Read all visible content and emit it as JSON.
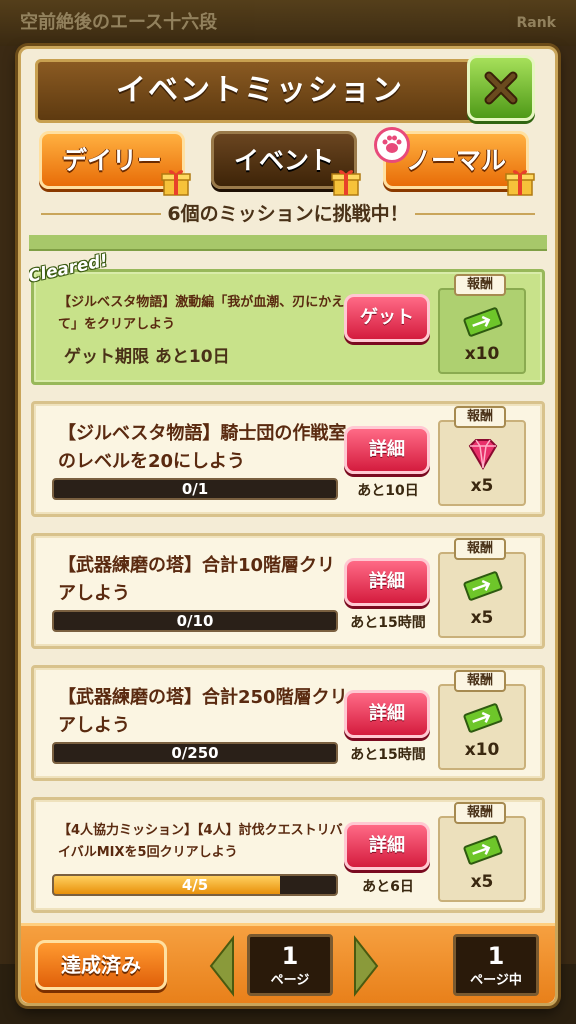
{
  "background": {
    "top_left_text": "空前絶後のエース十六段",
    "top_right_text": "Rank"
  },
  "header": {
    "title": "イベントミッション"
  },
  "tabs": [
    {
      "label": "デイリー"
    },
    {
      "label": "イベント"
    },
    {
      "label": "ノーマル"
    }
  ],
  "subtitle": "6個のミッションに挑戦中！",
  "missions": [
    {
      "cleared_tag": "Cleared!",
      "title": "【ジルベスタ物語】激動編「我が血潮、刃にかえて」をクリアしよう",
      "limit": "ゲット期限 あと10日",
      "button": "ゲット",
      "reward_label": "報酬",
      "reward_icon": "ticket-icon",
      "reward_qty": "x10"
    },
    {
      "title": "【ジルベスタ物語】騎士団の作戦室のレベルを20にしよう",
      "progress_text": "0/1",
      "progress": 0,
      "button": "詳細",
      "remaining": "あと10日",
      "reward_label": "報酬",
      "reward_icon": "gem-icon",
      "reward_qty": "x5"
    },
    {
      "title": "【武器練磨の塔】合計10階層クリアしよう",
      "progress_text": "0/10",
      "progress": 0,
      "button": "詳細",
      "remaining": "あと15時間",
      "reward_label": "報酬",
      "reward_icon": "ticket-icon",
      "reward_qty": "x5"
    },
    {
      "title": "【武器練磨の塔】合計250階層クリアしよう",
      "progress_text": "0/250",
      "progress": 0,
      "button": "詳細",
      "remaining": "あと15時間",
      "reward_label": "報酬",
      "reward_icon": "ticket-icon",
      "reward_qty": "x10"
    },
    {
      "title": "【4人協力ミッション】【4人】討伐クエストリバイバルMIXを5回クリアしよう",
      "progress_text": "4/5",
      "progress": 0.8,
      "button": "詳細",
      "remaining": "あと6日",
      "reward_label": "報酬",
      "reward_icon": "ticket-icon",
      "reward_qty": "x5"
    }
  ],
  "footer": {
    "done_button": "達成済み",
    "current_page": "1",
    "current_page_label": "ページ",
    "total_pages": "1",
    "total_pages_label": "ページ中"
  },
  "colors": {
    "accent_orange": "#e8801a",
    "cleared_green": "#c8e28a",
    "button_red": "#d41c3e",
    "progress_fill": "#e8900a"
  }
}
